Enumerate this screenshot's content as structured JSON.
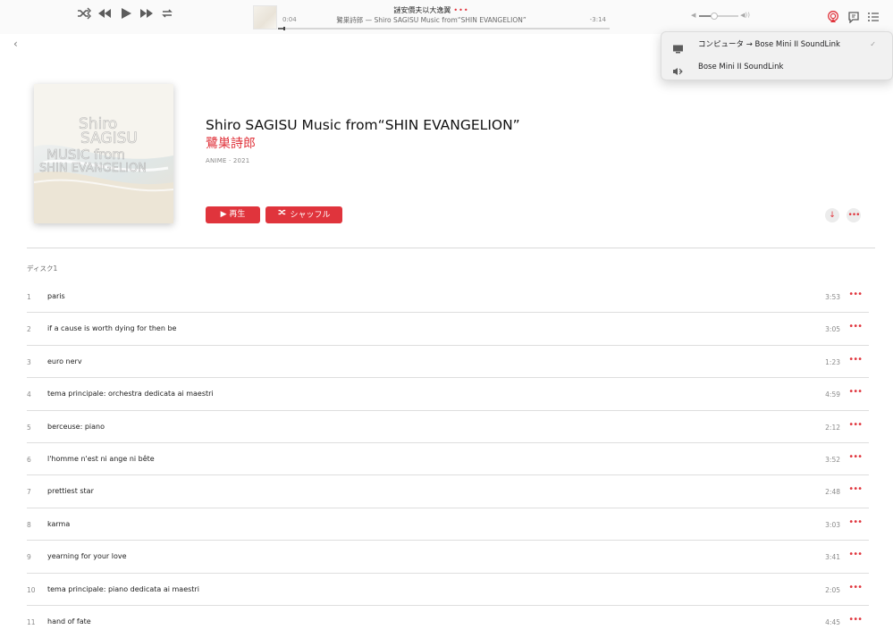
{
  "playback": {
    "shuffle_icon": "shuffle-icon",
    "prev_icon": "previous-icon",
    "play_icon": "play-icon",
    "next_icon": "next-icon",
    "repeat_icon": "repeat-icon"
  },
  "now_playing": {
    "title": "謎安價夫以大逸翼",
    "more": "•••",
    "subtitle": "鷺巣詩郎 — Shiro SAGISU Music from“SHIN EVANGELION”",
    "elapsed": "0:04",
    "remaining": "-3:14",
    "progress": 0.02
  },
  "volume": {
    "level": 0.38
  },
  "airplay_menu": {
    "items": [
      {
        "icon": "computer-icon",
        "label": "コンピュータ → Bose Mini II SoundLink",
        "checked": "✓"
      },
      {
        "icon": "bluetooth-icon",
        "label": "Bose Mini II SoundLink"
      }
    ]
  },
  "album": {
    "title": "Shiro SAGISU Music from“SHIN EVANGELION”",
    "artist": "鷺巣詩郎",
    "meta": "ANIME · 2021",
    "play_label": "▶ 再生",
    "shuffle_label": "シャッフル",
    "cover_text": [
      "Shiro",
      "SAGISU",
      "MUSIC from",
      "SHIN EVANGELION"
    ]
  },
  "disc_label": "ディスク1",
  "tracks": [
    {
      "num": "1",
      "name": "paris",
      "duration": "3:53"
    },
    {
      "num": "2",
      "name": "if a cause is worth dying for then be",
      "duration": "3:05"
    },
    {
      "num": "3",
      "name": "euro nerv",
      "duration": "1:23"
    },
    {
      "num": "4",
      "name": "tema principale: orchestra dedicata ai maestri",
      "duration": "4:59"
    },
    {
      "num": "5",
      "name": "berceuse: piano",
      "duration": "2:12"
    },
    {
      "num": "6",
      "name": "l'homme n'est ni ange ni bête",
      "duration": "3:52"
    },
    {
      "num": "7",
      "name": "prettiest star",
      "duration": "2:48"
    },
    {
      "num": "8",
      "name": "karma",
      "duration": "3:03"
    },
    {
      "num": "9",
      "name": "yearning for your love",
      "duration": "3:41"
    },
    {
      "num": "10",
      "name": "tema principale: piano dedicata ai maestri",
      "duration": "2:05"
    },
    {
      "num": "11",
      "name": "hand of fate",
      "duration": "4:45"
    }
  ],
  "colors": {
    "accent": "#e0343c"
  }
}
